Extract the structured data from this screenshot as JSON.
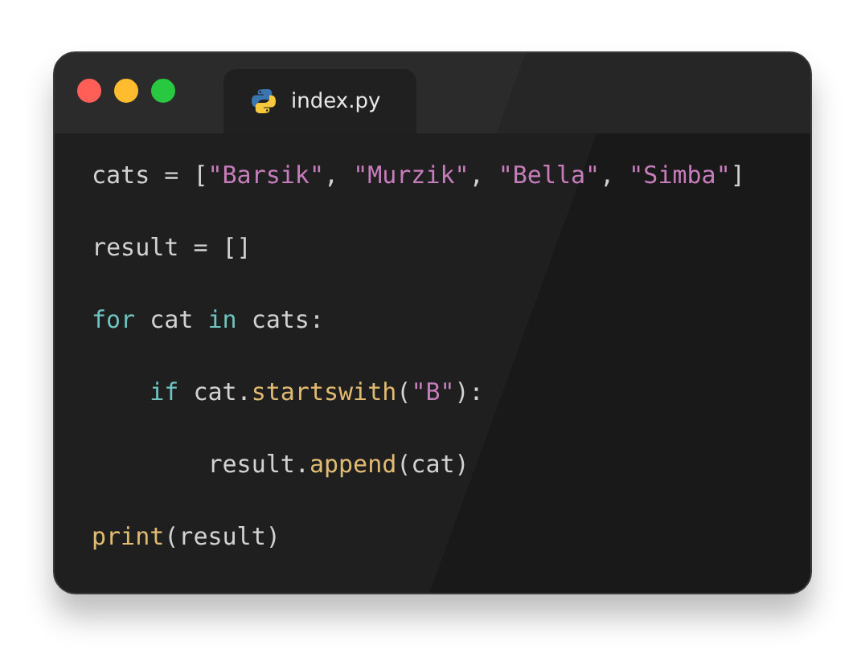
{
  "window": {
    "controls": [
      {
        "kind": "close"
      },
      {
        "kind": "minimize"
      },
      {
        "kind": "zoom"
      }
    ]
  },
  "tab": {
    "title": "index.py",
    "selected": true
  },
  "code_lines": [
    [
      {
        "kind": "plain",
        "text": "cats = ["
      },
      {
        "kind": "string",
        "text": "\"Barsik\""
      },
      {
        "kind": "plain",
        "text": ", "
      },
      {
        "kind": "string",
        "text": "\"Murzik\""
      },
      {
        "kind": "plain",
        "text": ", "
      },
      {
        "kind": "string",
        "text": "\"Bella\""
      },
      {
        "kind": "plain",
        "text": ", "
      },
      {
        "kind": "string",
        "text": "\"Simba\""
      },
      {
        "kind": "plain",
        "text": "]"
      }
    ],
    [
      {
        "kind": "plain",
        "text": "result = []"
      }
    ],
    [
      {
        "kind": "keyword",
        "text": "for"
      },
      {
        "kind": "plain",
        "text": " cat "
      },
      {
        "kind": "keyword",
        "text": "in"
      },
      {
        "kind": "plain",
        "text": " cats:"
      }
    ],
    [
      {
        "kind": "keyword",
        "text": "    if"
      },
      {
        "kind": "plain",
        "text": " cat."
      },
      {
        "kind": "function",
        "text": "startswith"
      },
      {
        "kind": "plain",
        "text": "("
      },
      {
        "kind": "string",
        "text": "\"B\""
      },
      {
        "kind": "plain",
        "text": "):"
      }
    ],
    [
      {
        "kind": "plain",
        "text": "        result."
      },
      {
        "kind": "function",
        "text": "append"
      },
      {
        "kind": "plain",
        "text": "(cat)"
      }
    ],
    [
      {
        "kind": "function",
        "text": "print"
      },
      {
        "kind": "plain",
        "text": "(result)"
      }
    ]
  ]
}
